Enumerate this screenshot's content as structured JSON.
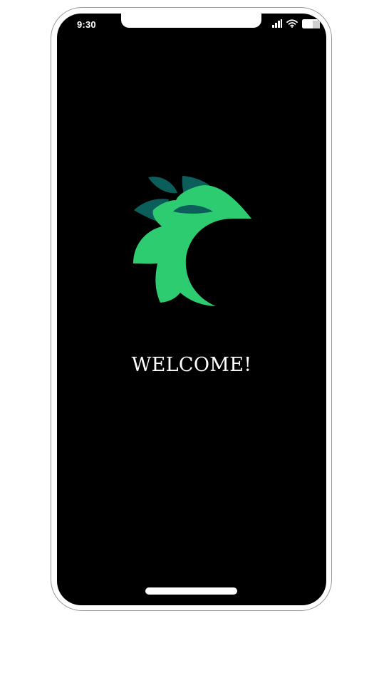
{
  "status_bar": {
    "time": "9:30",
    "icons": [
      "cellular-signal-icon",
      "wifi-icon",
      "battery-icon"
    ]
  },
  "splash": {
    "logo": "leafy-bird-logo",
    "welcome_text": "WELCOME!"
  },
  "colors": {
    "background": "#000000",
    "logo_primary": "#2ecc71",
    "logo_dark": "#0b5e5a",
    "text": "#ffffff"
  }
}
